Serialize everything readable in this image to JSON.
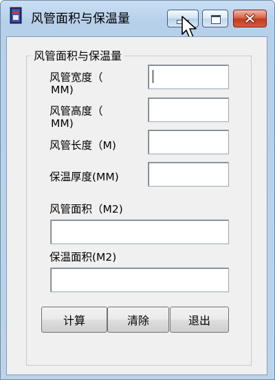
{
  "window": {
    "title": "风管面积与保温量"
  },
  "group": {
    "title": "风管面积与保温量"
  },
  "fields": {
    "width_label_line1": "风管宽度（",
    "width_label_line2": "MM)",
    "width_value": "",
    "height_label_line1": "风管高度（",
    "height_label_line2": "MM)",
    "height_value": "",
    "length_label": "风管长度（M)",
    "length_value": "",
    "insulation_thickness_label": "保温厚度(MM)",
    "insulation_thickness_value": "",
    "duct_area_label": "风管面积（M2)",
    "duct_area_value": "",
    "insulation_area_label": "保温面积(M2)",
    "insulation_area_value": ""
  },
  "buttons": {
    "calculate": "计算",
    "clear": "清除",
    "exit": "退出"
  },
  "colors": {
    "titlebar": "#b7d0ea",
    "client_background": "#f0f0f0",
    "close_button": "#c13c20"
  },
  "icons": {
    "app": "app-book-icon",
    "minimize": "minimize-icon",
    "maximize": "maximize-icon",
    "close": "close-icon",
    "cursor": "mouse-pointer-icon"
  }
}
